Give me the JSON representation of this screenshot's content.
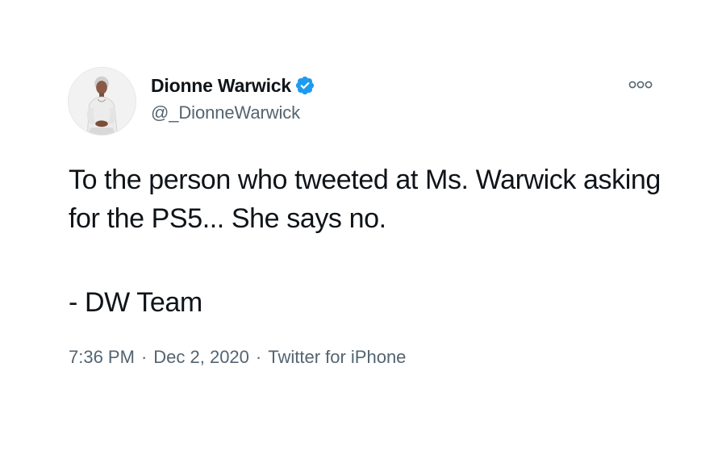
{
  "tweet": {
    "author": {
      "display_name": "Dionne Warwick",
      "handle": "@_DionneWarwick",
      "verified": true,
      "avatar_icon": "profile-photo"
    },
    "text_lines": [
      "To the person who tweeted at Ms. Warwick asking for the PS5... She says no.",
      "- DW Team"
    ],
    "time": "7:36 PM",
    "date": "Dec 2, 2020",
    "separator": "·",
    "source": "Twitter for iPhone",
    "more_icon": "more-icon"
  },
  "colors": {
    "text": "#0f1419",
    "secondary": "#536471",
    "verified": "#1d9bf0",
    "background": "#ffffff"
  }
}
